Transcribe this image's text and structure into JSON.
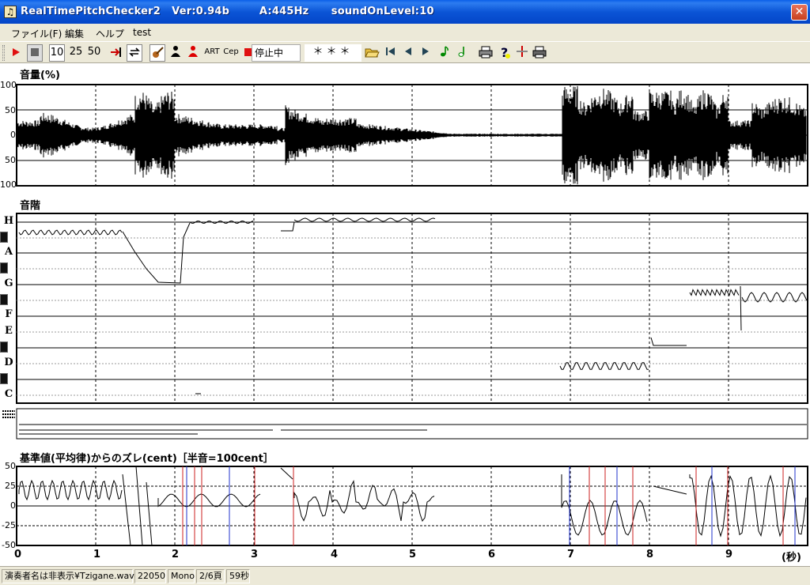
{
  "window": {
    "title": "RealTimePitchChecker2   Ver:0.94b        A:445Hz      soundOnLevel:10",
    "close_glyph": "✕",
    "icon_glyph": "♫"
  },
  "menu": [
    "ファイル(F)",
    "編集",
    "ヘルプ",
    "test"
  ],
  "toolbar": {
    "speeds": [
      "10",
      "25",
      "50"
    ],
    "art": "ART",
    "cep": "Cep",
    "status": "停止中",
    "note_display": "＊＊＊",
    "record_color": "#e01010"
  },
  "volume_panel": {
    "title": "音量(%)",
    "y_labels": [
      "100",
      "50",
      "0",
      "50",
      "100"
    ]
  },
  "scale_panel": {
    "title": "音階",
    "notes": [
      "H",
      "A",
      "G",
      "F",
      "E",
      "D",
      "C"
    ]
  },
  "cent_panel": {
    "title": "基準値(平均律)からのズレ(cent)［半音=100cent］",
    "y_labels": [
      "50",
      "25",
      "0",
      "-25",
      "-50"
    ]
  },
  "time_axis": {
    "labels": [
      "0",
      "1",
      "2",
      "3",
      "4",
      "5",
      "6",
      "7",
      "8",
      "9"
    ],
    "unit": "(秒)"
  },
  "statusbar": [
    "演奏者名は非表示¥Tzigane.wav",
    "22050",
    "Mono",
    "2/6頁",
    "59秒"
  ]
}
